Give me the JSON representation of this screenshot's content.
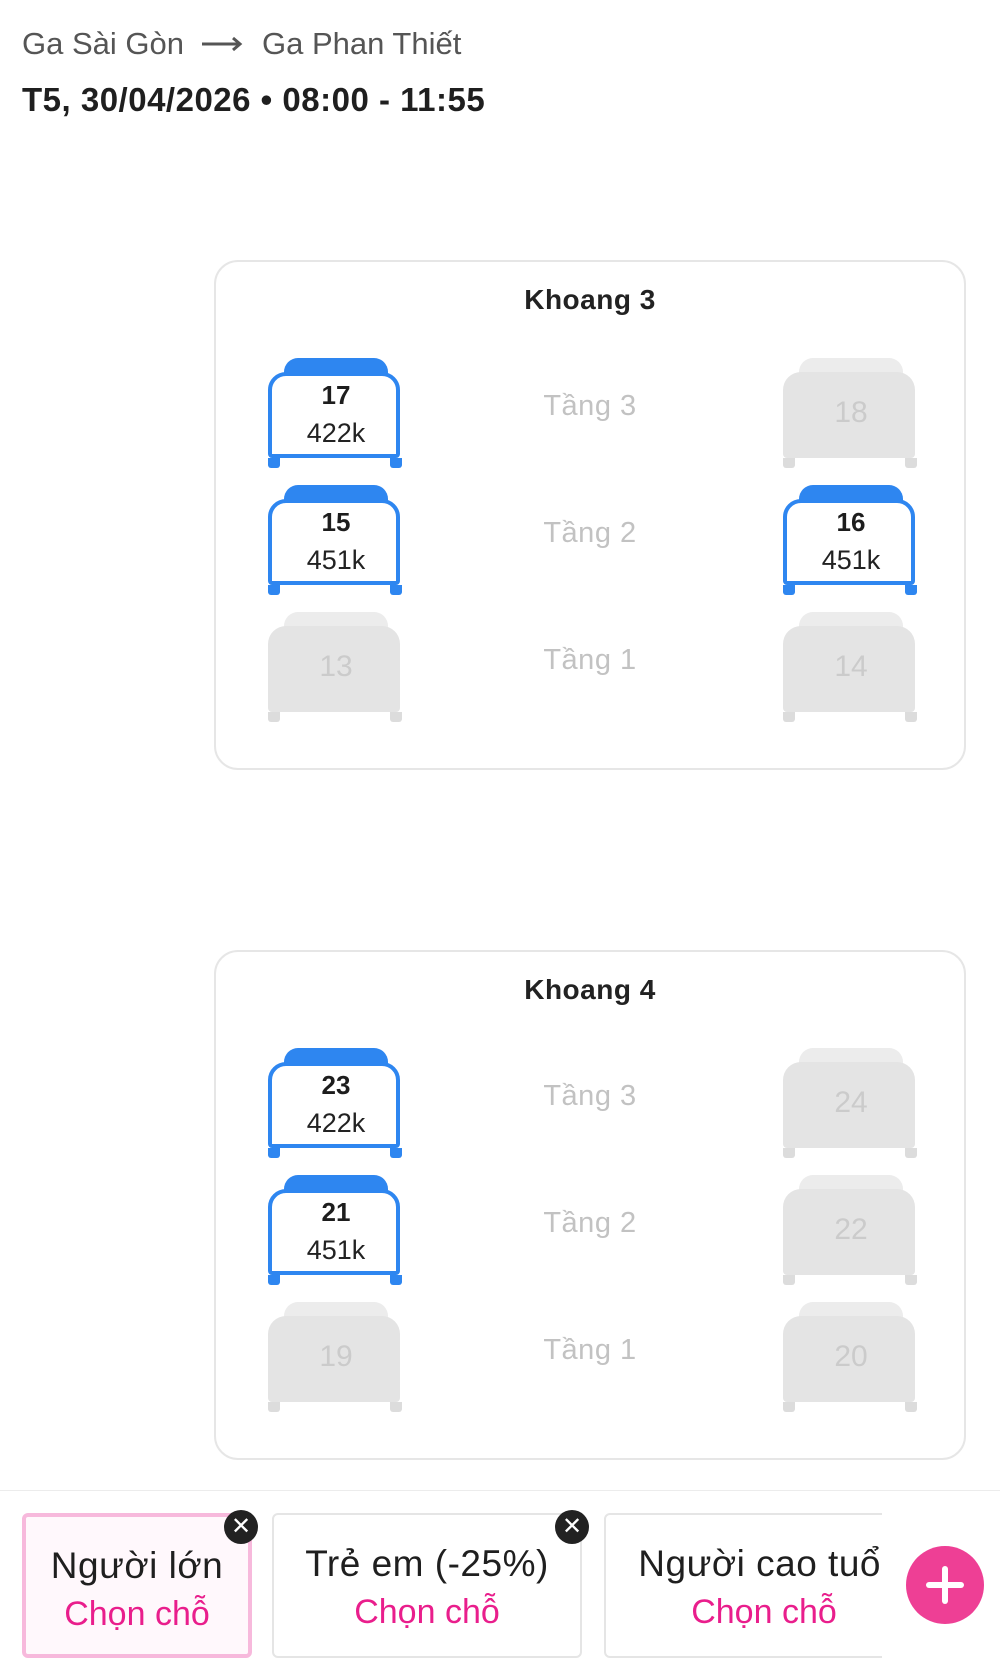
{
  "header": {
    "from": "Ga Sài Gòn",
    "to": "Ga Phan Thiết",
    "datetime": "T5, 30/04/2026 • 08:00 - 11:55"
  },
  "compartments": [
    {
      "title": "Khoang 3",
      "rows": [
        {
          "floor": "Tầng 3",
          "left": {
            "number": "17",
            "price": "422k",
            "status": "available"
          },
          "right": {
            "number": "18",
            "status": "unavailable"
          }
        },
        {
          "floor": "Tầng 2",
          "left": {
            "number": "15",
            "price": "451k",
            "status": "available"
          },
          "right": {
            "number": "16",
            "price": "451k",
            "status": "available"
          }
        },
        {
          "floor": "Tầng 1",
          "left": {
            "number": "13",
            "status": "unavailable"
          },
          "right": {
            "number": "14",
            "status": "unavailable"
          }
        }
      ]
    },
    {
      "title": "Khoang 4",
      "rows": [
        {
          "floor": "Tầng 3",
          "left": {
            "number": "23",
            "price": "422k",
            "status": "available"
          },
          "right": {
            "number": "24",
            "status": "unavailable"
          }
        },
        {
          "floor": "Tầng 2",
          "left": {
            "number": "21",
            "price": "451k",
            "status": "available"
          },
          "right": {
            "number": "22",
            "status": "unavailable"
          }
        },
        {
          "floor": "Tầng 1",
          "left": {
            "number": "19",
            "status": "unavailable"
          },
          "right": {
            "number": "20",
            "status": "unavailable"
          }
        }
      ]
    }
  ],
  "passengers": [
    {
      "label": "Người lớn",
      "action": "Chọn chỗ",
      "active": true
    },
    {
      "label": "Trẻ em (-25%)",
      "action": "Chọn chỗ",
      "active": false
    },
    {
      "label": "Người cao tuổi",
      "action": "Chọn chỗ",
      "active": false
    }
  ],
  "icons": {
    "close": "close-icon",
    "add": "plus-icon",
    "arrow": "arrow-right-icon"
  },
  "colors": {
    "available": "#2e86f0",
    "unavailable": "#e4e4e4",
    "accent": "#e91e8c",
    "add_button": "#ee3f95"
  }
}
